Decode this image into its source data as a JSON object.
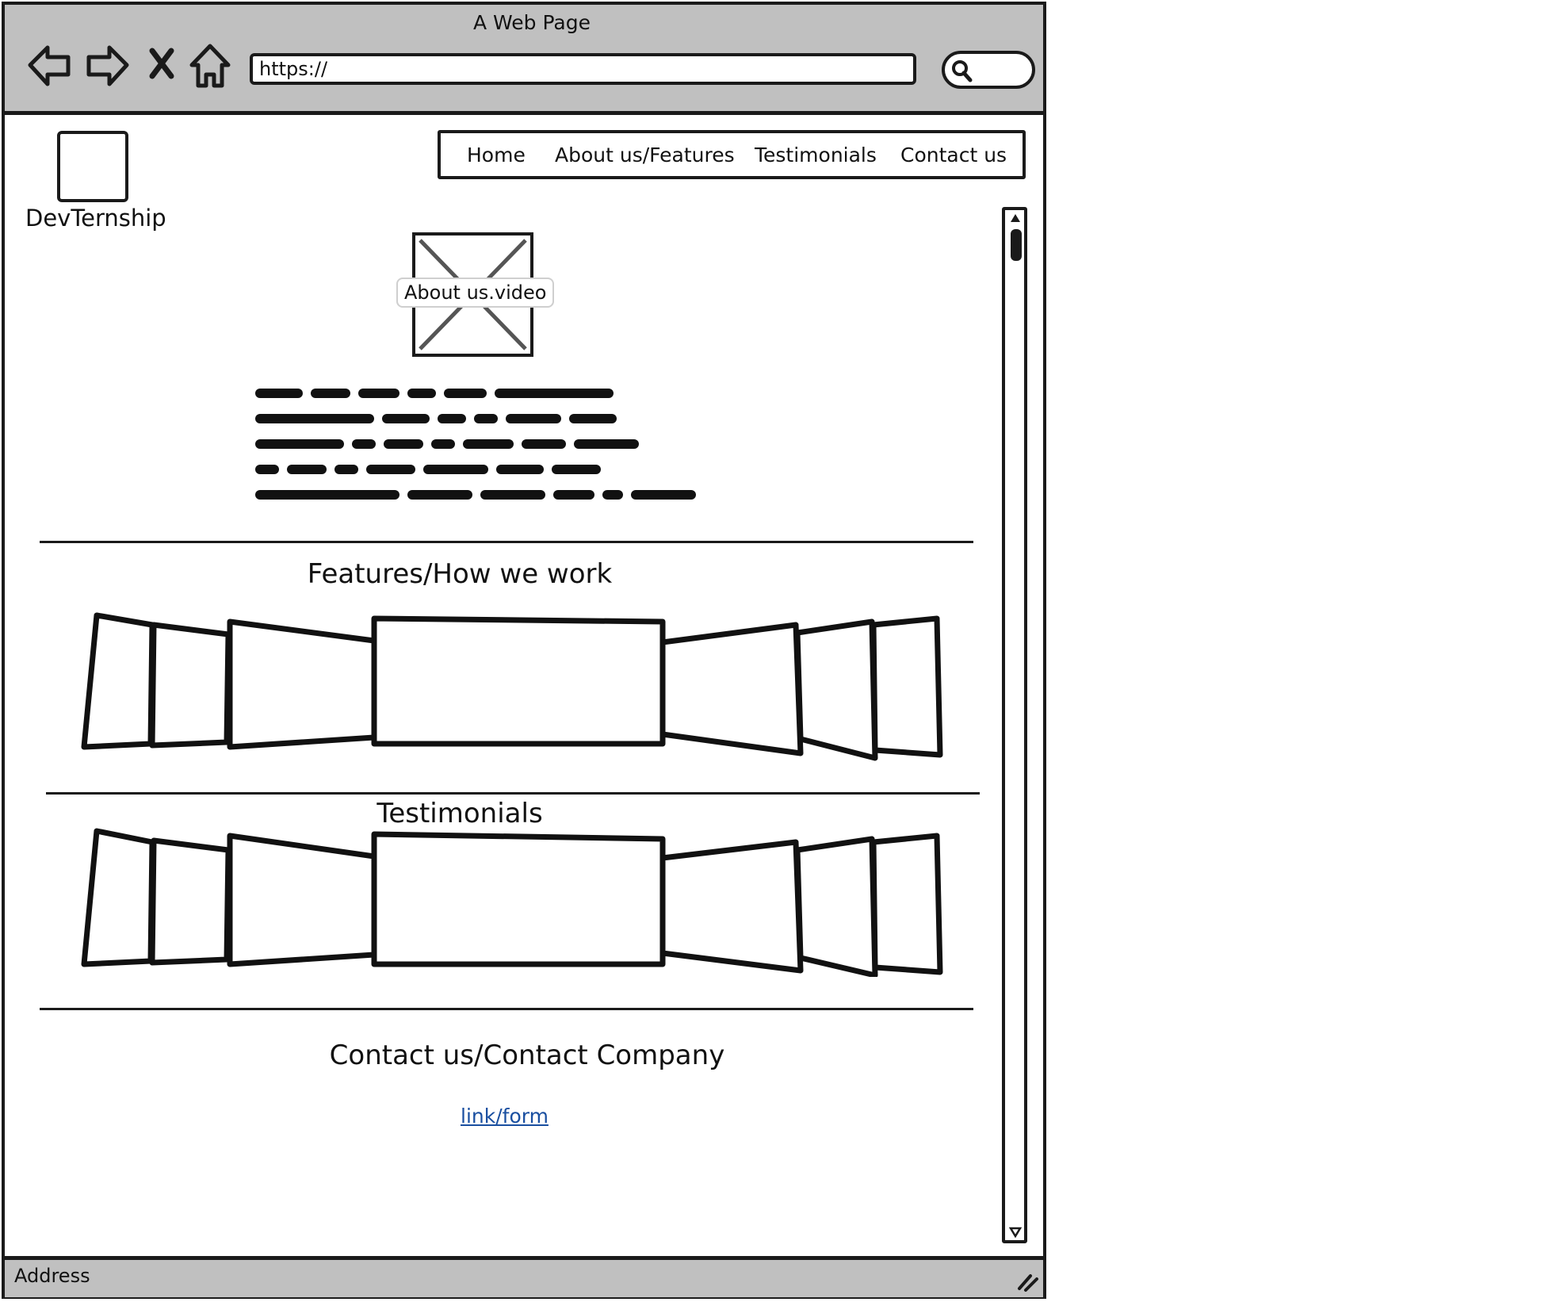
{
  "browser": {
    "title": "A Web Page",
    "url": "https://",
    "status": "Address",
    "nav_icons": [
      "back-arrow-icon",
      "forward-arrow-icon",
      "stop-icon",
      "home-icon",
      "search-icon",
      "resize-grip-icon"
    ]
  },
  "site": {
    "logo_text": "DevTernship",
    "nav": [
      "Home",
      "About us/Features",
      "Testimonials",
      "Contact us"
    ]
  },
  "about": {
    "video_label": "About us.video"
  },
  "features": {
    "title": "Features/How we work"
  },
  "testimonials": {
    "title": "Testimonials"
  },
  "contact": {
    "title": "Contact us/Contact Company",
    "link": "link/form "
  },
  "colors": {
    "chrome": "#c0c0c0",
    "ink": "#1a1a1a",
    "link": "#1a4fa0"
  }
}
